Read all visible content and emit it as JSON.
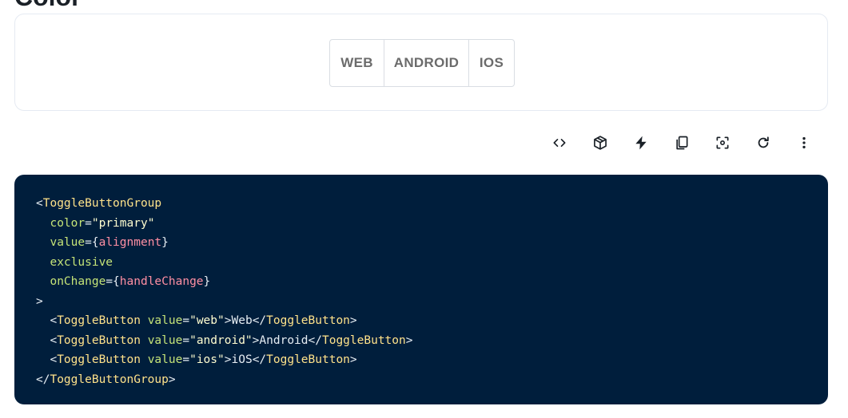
{
  "page": {
    "section_heading": "Color"
  },
  "demo": {
    "toggle_buttons": [
      {
        "label": "WEB"
      },
      {
        "label": "ANDROID"
      },
      {
        "label": "IOS"
      }
    ]
  },
  "toolbar": {
    "icons": [
      "code-icon",
      "codesandbox-icon",
      "stackblitz-icon",
      "copy-icon",
      "reset-focus-icon",
      "refresh-icon",
      "more-vert-icon"
    ]
  },
  "code": {
    "line1_tag": "ToggleButtonGroup",
    "line2_attr": "color",
    "line2_val": "\"primary\"",
    "line3_attr": "value",
    "line3_expr": "alignment",
    "line4_attr": "exclusive",
    "line5_attr": "onChange",
    "line5_expr": "handleChange",
    "child_tag": "ToggleButton",
    "child_attr": "value",
    "child1_val": "\"web\"",
    "child1_text": "Web",
    "child2_val": "\"android\"",
    "child2_text": "Android",
    "child3_val": "\"ios\"",
    "child3_text": "iOS",
    "close_tag": "ToggleButtonGroup"
  },
  "colors": {
    "code_bg": "#001e3c",
    "tag": "#ffe28a",
    "attr": "#c5e478",
    "expression": "#ff8fa3"
  }
}
